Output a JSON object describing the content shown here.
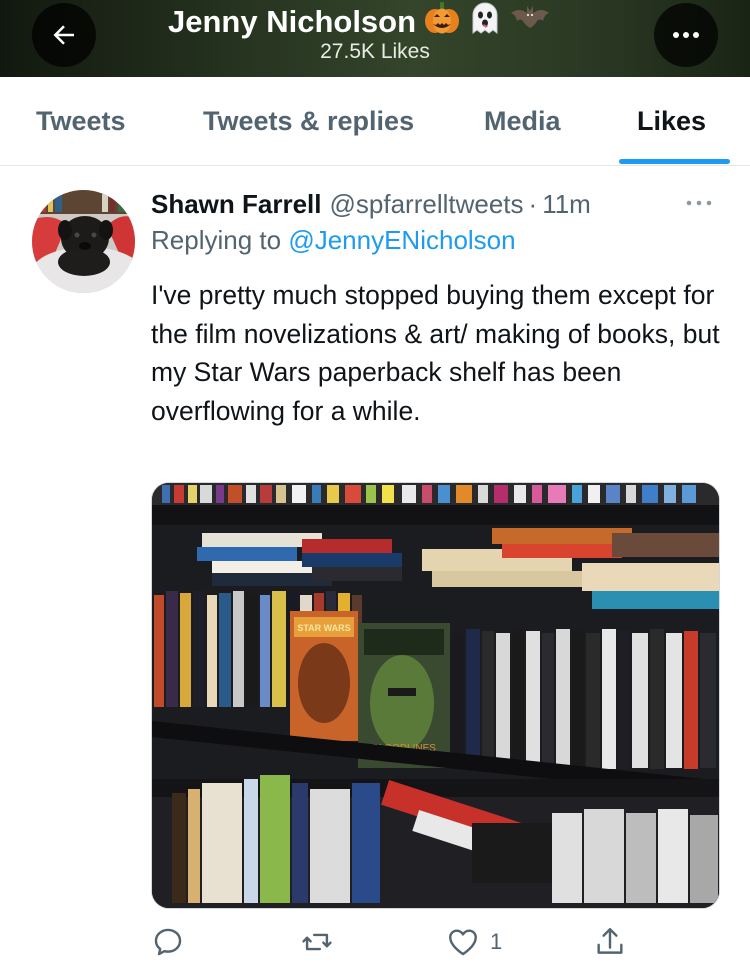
{
  "header": {
    "title": "Jenny Nicholson",
    "title_emojis": [
      "🎃",
      "👻",
      "🦇"
    ],
    "subtitle": "27.5K Likes",
    "back_icon": "arrow-left-icon",
    "more_icon": "more-horizontal-icon"
  },
  "tabs": [
    {
      "label": "Tweets",
      "active": false
    },
    {
      "label": "Tweets & replies",
      "active": false
    },
    {
      "label": "Media",
      "active": false
    },
    {
      "label": "Likes",
      "active": true
    }
  ],
  "tweet": {
    "author_name": "Shawn Farrell",
    "handle": "@spfarrelltweets",
    "separator": "·",
    "time": "11m",
    "replying_prefix": "Replying to",
    "replying_to": "@JennyENicholson",
    "text": "I've pretty much stopped buying them except for the film novelizations & art/ making of books, but my Star Wars paperback shelf has been overflowing for a while.",
    "actions": {
      "reply_count": "",
      "retweet_count": "",
      "like_count": "1"
    }
  },
  "colors": {
    "accent": "#1d9bf0",
    "secondary_text": "#536471",
    "primary_text": "#0f1419"
  }
}
